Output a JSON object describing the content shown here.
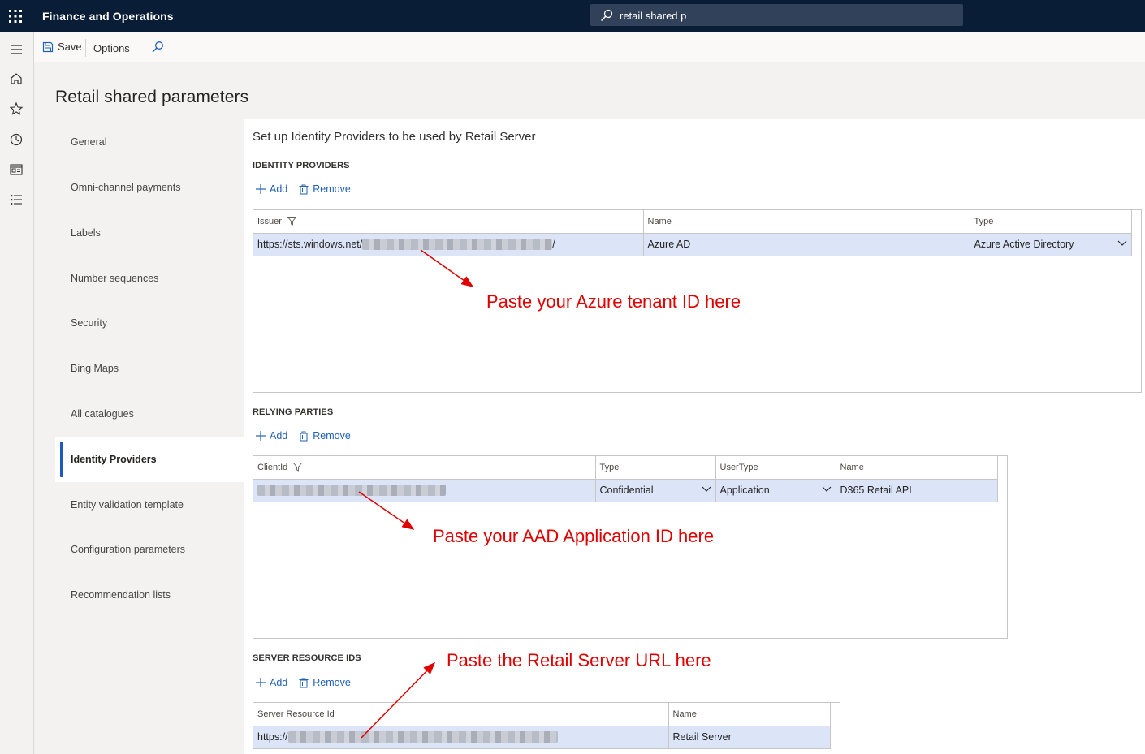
{
  "app": {
    "title": "Finance and Operations"
  },
  "search": {
    "value": "retail shared p"
  },
  "toolbar": {
    "save_label": "Save",
    "options_label": "Options"
  },
  "page": {
    "title": "Retail shared parameters"
  },
  "tabs": [
    {
      "label": "General"
    },
    {
      "label": "Omni-channel payments"
    },
    {
      "label": "Labels"
    },
    {
      "label": "Number sequences"
    },
    {
      "label": "Security"
    },
    {
      "label": "Bing Maps"
    },
    {
      "label": "All catalogues"
    },
    {
      "label": "Identity Providers",
      "active": true
    },
    {
      "label": "Entity validation template"
    },
    {
      "label": "Configuration parameters"
    },
    {
      "label": "Recommendation lists"
    }
  ],
  "content": {
    "heading": "Set up Identity Providers to be used by Retail Server",
    "add_label": "Add",
    "remove_label": "Remove",
    "identity_providers": {
      "title": "IDENTITY PROVIDERS",
      "columns": [
        "Issuer",
        "Name",
        "Type"
      ],
      "row": {
        "issuer_prefix": "https://sts.windows.net/",
        "issuer_suffix": "/",
        "name": "Azure AD",
        "type": "Azure Active Directory"
      }
    },
    "relying_parties": {
      "title": "RELYING PARTIES",
      "columns": [
        "ClientId",
        "Type",
        "UserType",
        "Name"
      ],
      "row": {
        "type": "Confidential",
        "user_type": "Application",
        "name": "D365 Retail API"
      }
    },
    "server_resource_ids": {
      "title": "SERVER RESOURCE IDS",
      "columns": [
        "Server Resource Id",
        "Name"
      ],
      "row": {
        "id_prefix": "https://",
        "name": "Retail Server"
      }
    }
  },
  "annotations": {
    "tenant": "Paste your Azure tenant ID here",
    "app_id": "Paste your AAD Application ID here",
    "server_url": "Paste the Retail Server URL here"
  },
  "colors": {
    "topbar": "#0a1d37",
    "accent": "#1e58c4",
    "link": "#2160b8",
    "selected_row": "#dce5f8",
    "annotation": "#e00000"
  }
}
